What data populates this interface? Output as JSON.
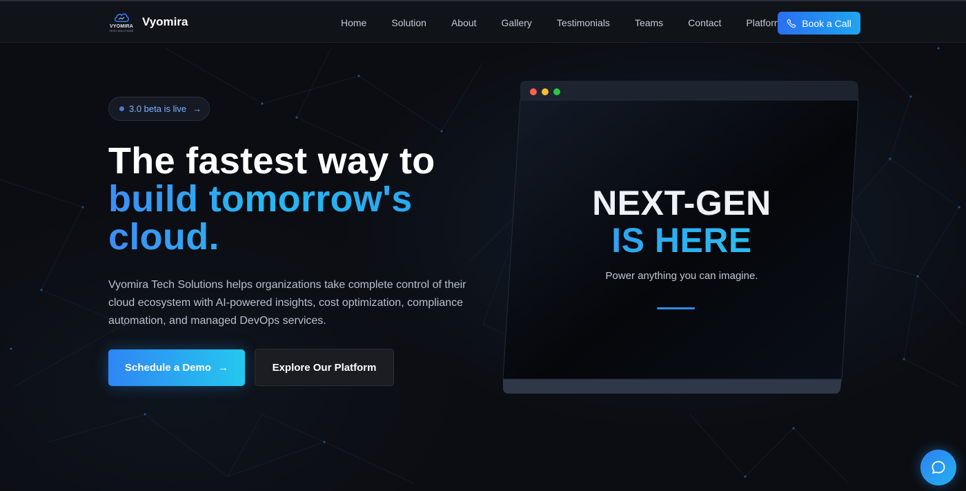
{
  "brand": {
    "logo_word": "VYOMIRA",
    "logo_sub": "TECH SOLUTIONS",
    "name": "Vyomira",
    "icon": "cloud-logo-icon"
  },
  "nav": {
    "links": [
      "Home",
      "Solution",
      "About",
      "Gallery",
      "Testimonials",
      "Teams",
      "Contact",
      "Platform"
    ],
    "cta_label": "Book a Call",
    "cta_icon": "phone-icon"
  },
  "hero": {
    "badge_text": "3.0 beta is live",
    "badge_arrow": "→",
    "headline_line1": "The fastest way to",
    "headline_line2": "build tomorrow's",
    "headline_line3": "cloud.",
    "description": "Vyomira Tech Solutions helps organizations take complete control of their cloud ecosystem with AI-powered insights, cost optimization, compliance automation, and managed DevOps services.",
    "primary_button": "Schedule a Demo",
    "primary_arrow": "→",
    "secondary_button": "Explore Our Platform"
  },
  "screen": {
    "line1": "NEXT-GEN",
    "line2": "IS HERE",
    "subtitle": "Power anything you can imagine."
  },
  "chat": {
    "icon": "chat-bubble-icon"
  },
  "colors": {
    "background": "#0b0d12",
    "accent_blue": "#2f86f4",
    "accent_cyan": "#25c8ee",
    "window_red": "#ff5f57",
    "window_yellow": "#febc2e",
    "window_green": "#28c840"
  }
}
